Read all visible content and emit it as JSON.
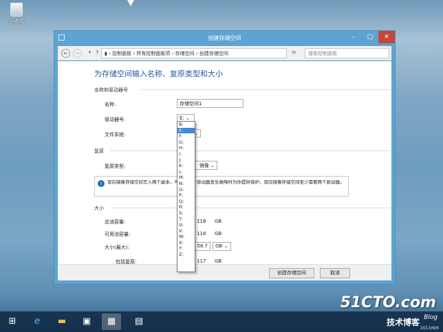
{
  "desktop": {
    "recycle_label": "回收站"
  },
  "window": {
    "title": "创建存储空间",
    "min": "–",
    "max": "□",
    "close": "✕"
  },
  "address": {
    "crumbs": "▮  › 控制面板  ›  所有控制面板项  ›  存储空间  ›  创建存储空间",
    "search_placeholder": "搜索控制面板"
  },
  "page": {
    "heading": "为存储空间输入名称、复原类型和大小",
    "section_name": "名称和驱动器号",
    "name_label": "名称:",
    "name_value": "存储空间1",
    "drive_label": "驱动器号:",
    "drive_value": "E:",
    "fs_label": "文件系统:",
    "section_resiliency": "复原",
    "resiliency_label": "复原类型:",
    "resiliency_value": "镜像",
    "info_text": "双向镜像存储空间写入两个副本，可以在一个驱动器发生故障时为你提供保护。双向镜像存储空间至少需要两个驱动器。",
    "section_size": "大小",
    "total_label": "总池容量:",
    "total_value": "118",
    "total_unit": "GB",
    "avail_label": "可用池容量:",
    "avail_value": "118",
    "avail_unit": "GB",
    "size_label": "大小(最大):",
    "size_value": "58.7",
    "size_unit": "GB",
    "incl_label": "包括复原:",
    "incl_value": "117",
    "incl_unit": "GB"
  },
  "drive_options": [
    "B:",
    "E:",
    "F:",
    "G:",
    "H:",
    "I:",
    "J:",
    "K:",
    "L:",
    "M:",
    "N:",
    "O:",
    "P:",
    "Q:",
    "R:",
    "S:",
    "T:",
    "U:",
    "V:",
    "W:",
    "X:",
    "Y:",
    "Z:"
  ],
  "buttons": {
    "create": "创建存储空间",
    "cancel": "取消"
  },
  "watermark": {
    "site": "51CTO.com",
    "brand": "技术博客",
    "blog": "Blog",
    "date": "2013/6/6"
  }
}
